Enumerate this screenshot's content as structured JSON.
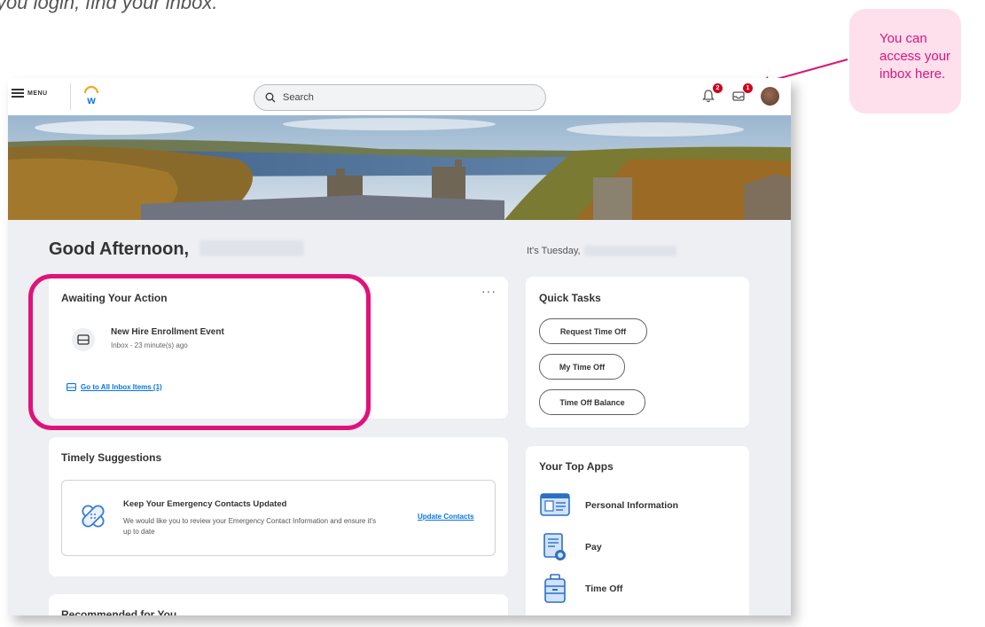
{
  "caption": "you login, find your inbox.",
  "callout": {
    "text": "You can access your inbox here."
  },
  "topbar": {
    "menu_label": "MENU",
    "search_placeholder": "Search",
    "notifications_count": "2",
    "inbox_count": "1"
  },
  "greeting": {
    "text": "Good Afternoon,"
  },
  "date": {
    "prefix": "It's Tuesday,"
  },
  "awaiting": {
    "title": "Awaiting Your Action",
    "more": "···",
    "task_title": "New Hire Enrollment Event",
    "task_sub": "Inbox - 23 minute(s) ago",
    "link": "Go to All Inbox Items (1)"
  },
  "timely": {
    "title": "Timely Suggestions",
    "suggestion_title": "Keep Your Emergency Contacts Updated",
    "suggestion_body": "We would like you to review your Emergency Contact Information and ensure it's up to date",
    "action": "Update Contacts"
  },
  "recommended": {
    "title": "Recommended for You"
  },
  "quick_tasks": {
    "title": "Quick Tasks",
    "buttons": [
      "Request Time Off",
      "My Time Off",
      "Time Off Balance"
    ]
  },
  "top_apps": {
    "title": "Your Top Apps",
    "items": [
      {
        "label": "Personal Information",
        "icon": "id-card-icon"
      },
      {
        "label": "Pay",
        "icon": "pay-document-icon"
      },
      {
        "label": "Time Off",
        "icon": "suitcase-icon"
      }
    ]
  },
  "colors": {
    "accent_pink": "#e0127a",
    "link_blue": "#0875e1",
    "badge_red": "#d0021b"
  }
}
